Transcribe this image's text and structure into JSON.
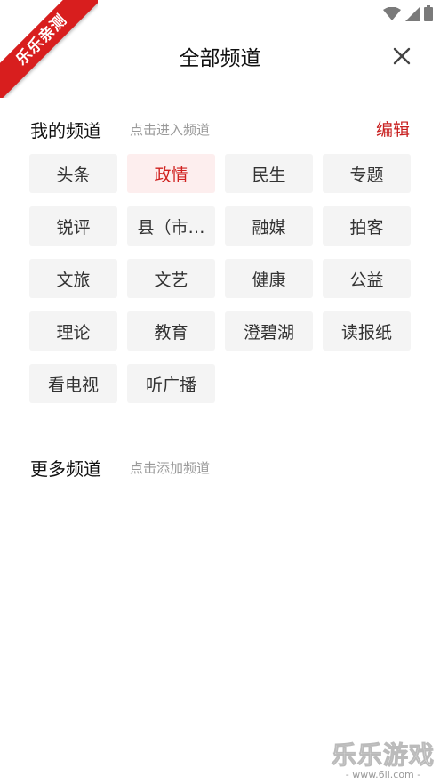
{
  "watermark": {
    "ribbon_text": "乐乐亲测",
    "corner_big": "乐乐游戏",
    "corner_small": "- www.6ll.com -"
  },
  "status_bar": {
    "icons": [
      "wifi-icon",
      "signal-icon",
      "battery-icon"
    ]
  },
  "header": {
    "title": "全部频道",
    "close_icon": "close-icon"
  },
  "my_channels": {
    "title": "我的频道",
    "hint": "点击进入频道",
    "edit_label": "编辑",
    "active_color": "#d0211f",
    "items": [
      {
        "label": "头条",
        "active": false
      },
      {
        "label": "政情",
        "active": true
      },
      {
        "label": "民生",
        "active": false
      },
      {
        "label": "专题",
        "active": false
      },
      {
        "label": "锐评",
        "active": false
      },
      {
        "label": "县（市…",
        "active": false
      },
      {
        "label": "融媒",
        "active": false
      },
      {
        "label": "拍客",
        "active": false
      },
      {
        "label": "文旅",
        "active": false
      },
      {
        "label": "文艺",
        "active": false
      },
      {
        "label": "健康",
        "active": false
      },
      {
        "label": "公益",
        "active": false
      },
      {
        "label": "理论",
        "active": false
      },
      {
        "label": "教育",
        "active": false
      },
      {
        "label": "澄碧湖",
        "active": false
      },
      {
        "label": "读报纸",
        "active": false
      },
      {
        "label": "看电视",
        "active": false
      },
      {
        "label": "听广播",
        "active": false
      }
    ]
  },
  "more_channels": {
    "title": "更多频道",
    "hint": "点击添加频道"
  }
}
